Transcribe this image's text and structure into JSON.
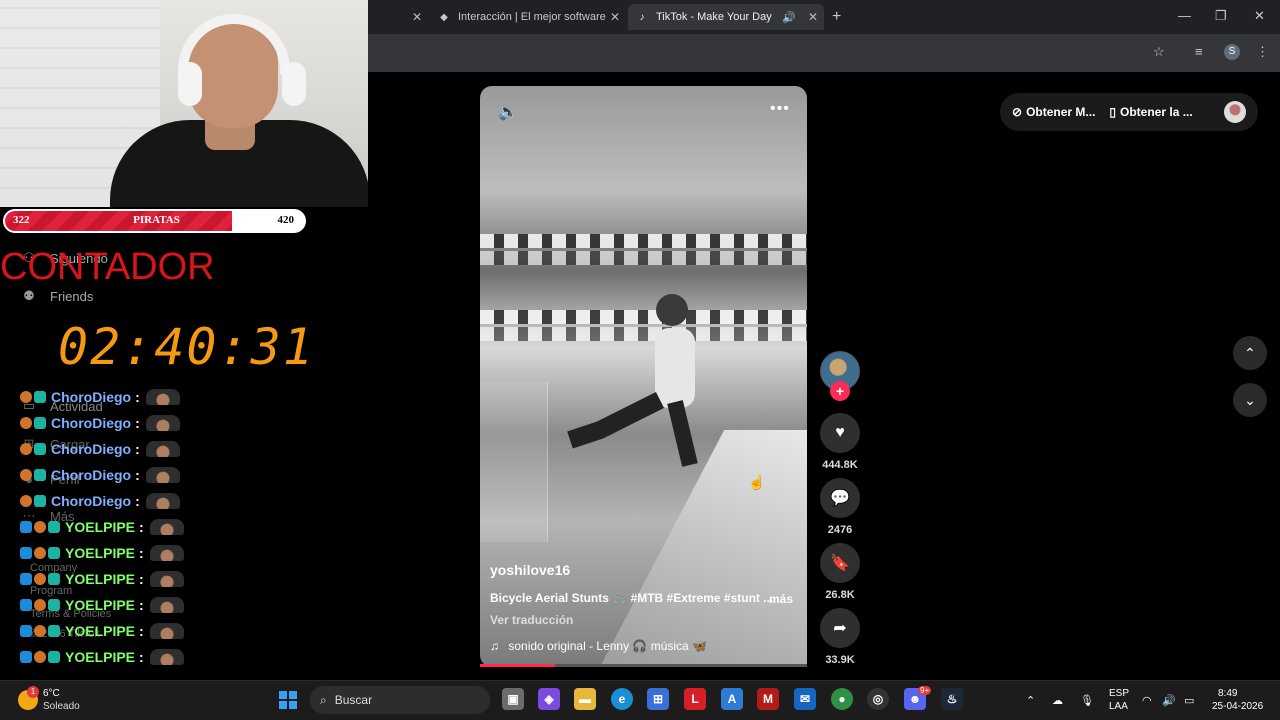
{
  "browser": {
    "tabs": [
      {
        "label": "Interacción | El mejor software p",
        "favicon": "◆"
      },
      {
        "label": "TikTok - Make Your Day",
        "favicon": "♪"
      }
    ],
    "tab_close": "✕",
    "new_tab": "+",
    "window_controls": {
      "minimize": "—",
      "restore": "❐",
      "close": "✕"
    },
    "profile_initial": "S"
  },
  "overlay": {
    "score": {
      "left": "322",
      "team": "PIRATAS",
      "right": "420",
      "fill_fraction": 0.76
    },
    "counter_title": "CONTADOR",
    "timer": "02:40:31",
    "chat": [
      {
        "name": "ChoroDiego",
        "color": "#7fb0ff",
        "sep": ":"
      },
      {
        "name": "ChoroDiego",
        "color": "#7fb0ff",
        "sep": ":"
      },
      {
        "name": "ChoroDiego",
        "color": "#7fb0ff",
        "sep": ":"
      },
      {
        "name": "ChoroDiego",
        "color": "#7fb0ff",
        "sep": ":"
      },
      {
        "name": "ChoroDiego",
        "color": "#7fb0ff",
        "sep": ":"
      },
      {
        "name": "YOELPIPE",
        "color": "#7fff6a",
        "sep": ":"
      },
      {
        "name": "YOELPIPE",
        "color": "#7fff6a",
        "sep": ":"
      },
      {
        "name": "YOELPIPE",
        "color": "#7fff6a",
        "sep": ":"
      },
      {
        "name": "YOELPIPE",
        "color": "#7fff6a",
        "sep": ":"
      },
      {
        "name": "YOELPIPE",
        "color": "#7fff6a",
        "sep": ":"
      },
      {
        "name": "YOELPIPE",
        "color": "#7fff6a",
        "sep": ":"
      }
    ]
  },
  "sidebar": {
    "items": [
      {
        "label": "Siguiendo",
        "icon": "following-icon"
      },
      {
        "label": "Friends",
        "icon": "friends-icon"
      },
      {
        "label": "Actividad",
        "icon": "activity-icon"
      },
      {
        "label": "Cargar",
        "icon": "upload-icon"
      },
      {
        "label": "Perfil",
        "icon": "profile-icon"
      },
      {
        "label": "Más",
        "icon": "more-icon"
      }
    ],
    "footer": [
      "Company",
      "Program",
      "Terms & Policies",
      "© 2026 TikTok"
    ]
  },
  "video": {
    "username": "yoshilove16",
    "description": "Bicycle Aerial Stunts 🚲 #MTB #Extreme #stunt ...",
    "more": "más",
    "translate": "Ver traducción",
    "sound_note": "♫",
    "sound": "sonido original - Lenny 🎧 música 🦋",
    "progress_fraction": 0.23
  },
  "actions": {
    "likes": "444.8K",
    "comments": "2476",
    "saves": "26.8K",
    "shares": "33.9K",
    "follow": "+"
  },
  "top_pill": {
    "item1": "Obtener M...",
    "item2": "Obtener la ..."
  },
  "taskbar": {
    "weather_temp": "6°C",
    "weather_desc": "Soleado",
    "weather_badge": "1",
    "search_placeholder": "Buscar",
    "lang_top": "ESP",
    "lang_bottom": "LAA",
    "time": "8:49",
    "date": "25-04-2026",
    "discord_badge": "9+"
  },
  "colors": {
    "accent": "#fe2c55",
    "timer": "#f39a12",
    "counter": "#d9141c"
  }
}
